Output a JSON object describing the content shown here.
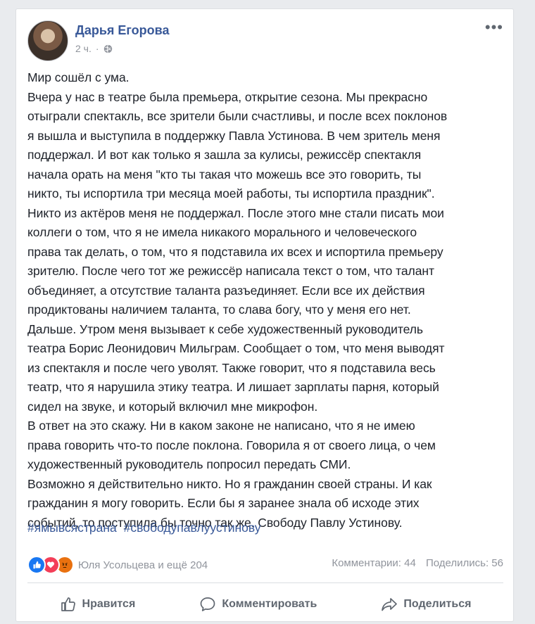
{
  "post": {
    "author": "Дарья Егорова",
    "time": "2 ч.",
    "privacy_icon": "globe-icon",
    "more": "•••",
    "lines": [
      "Мир сошёл с ума.",
      "Вчера у нас в театре была премьера, открытие сезона. Мы прекрасно",
      "отыграли спектакль, все зрители были счастливы, и после всех поклонов",
      "я вышла и выступила в поддержку Павла Устинова. В чем зритель меня",
      "поддержал. И вот как только я зашла за кулисы, режиссёр спектакля",
      "начала орать на меня \"кто ты такая что можешь все это говорить, ты",
      "никто, ты испортила три месяца моей работы, ты испортила праздник\".",
      "Никто из актёров меня не поддержал. После этого мне стали писать мои",
      "коллеги о том, что я не имела никакого морального и человеческого",
      "права так делать, о том, что я подставила их всех и испортила премьеру",
      "зрителю. После чего тот же режиссёр написала текст о том, что талант",
      "объединяет, а отсутствие таланта разъединяет. Если все их действия",
      "продиктованы наличием таланта, то слава богу, что у меня его нет.",
      "Дальше. Утром меня вызывает к себе художественный руководитель",
      "театра Борис Леонидович Мильграм. Сообщает о том, что меня выводят",
      "из спектакля и после чего уволят. Также говорит, что я подставила весь",
      "театр, что я нарушила этику театра. И лишает зарплаты парня, который",
      "сидел на звуке, и который включил мне микрофон.",
      "В ответ на это скажу. Ни в каком законе не написано, что я не имею",
      "права говорить что-то после поклона. Говорила я от своего лица, о чем",
      "художественный руководитель попросил передать СМИ.",
      "Возможно я действительно никто. Но я гражданин своей страны. И как",
      "гражданин я могу говорить. Если бы я заранее знала об исходе этих",
      "событий, то поступила бы точно так же. Свободу Павлу Устинову."
    ],
    "hashtags": [
      "#ямывсястрана",
      "#свободупавлуустинову"
    ]
  },
  "stats": {
    "reactions": [
      "like",
      "love",
      "angry"
    ],
    "reaction_names": "Юля Усольцева и ещё 204",
    "comments": "Комментарии: 44",
    "shares": "Поделились: 56"
  },
  "actions": {
    "like": "Нравится",
    "comment": "Комментировать",
    "share": "Поделиться"
  },
  "colors": {
    "link": "#385898",
    "text": "#1d2129",
    "muted": "#90949c",
    "background": "#e9ebee"
  }
}
